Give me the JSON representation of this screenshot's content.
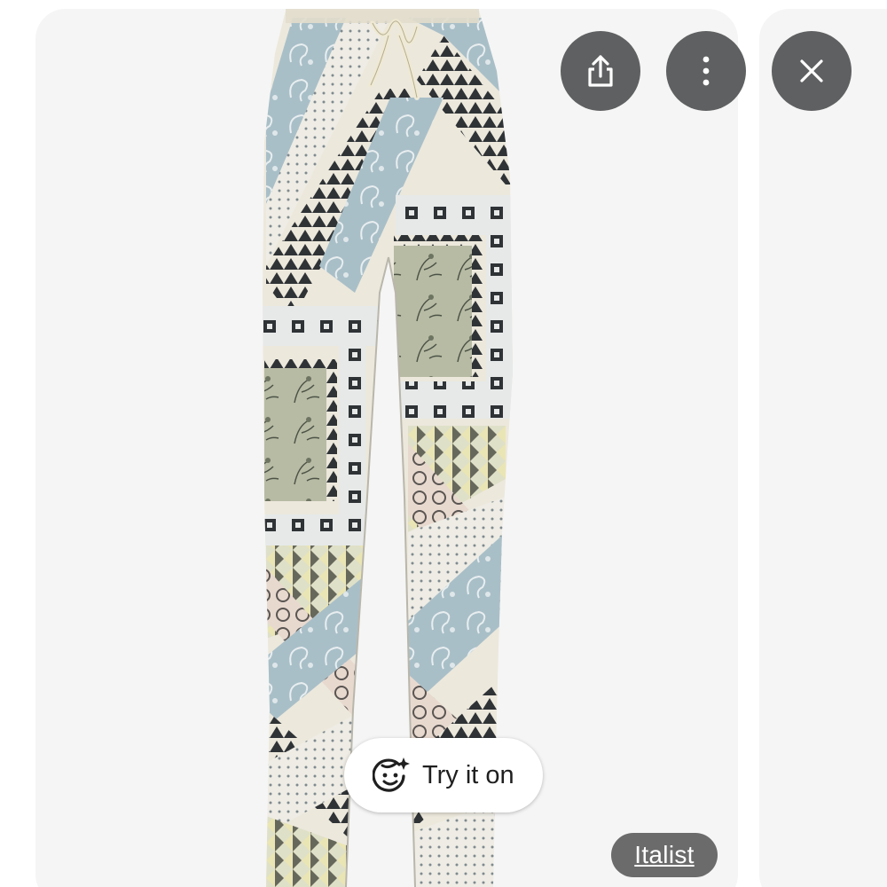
{
  "viewer": {
    "actions": {
      "share_icon": "share-icon",
      "more_icon": "more-vert-icon",
      "close_icon": "close-icon"
    },
    "try_on": {
      "icon": "face-sparkle-icon",
      "label": "Try it on"
    },
    "source": {
      "label": "Italist"
    },
    "product_image": {
      "subject": "patterned drawstring trousers"
    }
  },
  "colors": {
    "card_background": "#f5f5f5",
    "action_button": "#5f6061",
    "source_chip": "#6b6b6b",
    "pattern_cream": "#ece8dc",
    "pattern_blue": "#a9bfc8",
    "pattern_sage": "#b7bba4",
    "pattern_dark": "#2f3336"
  }
}
